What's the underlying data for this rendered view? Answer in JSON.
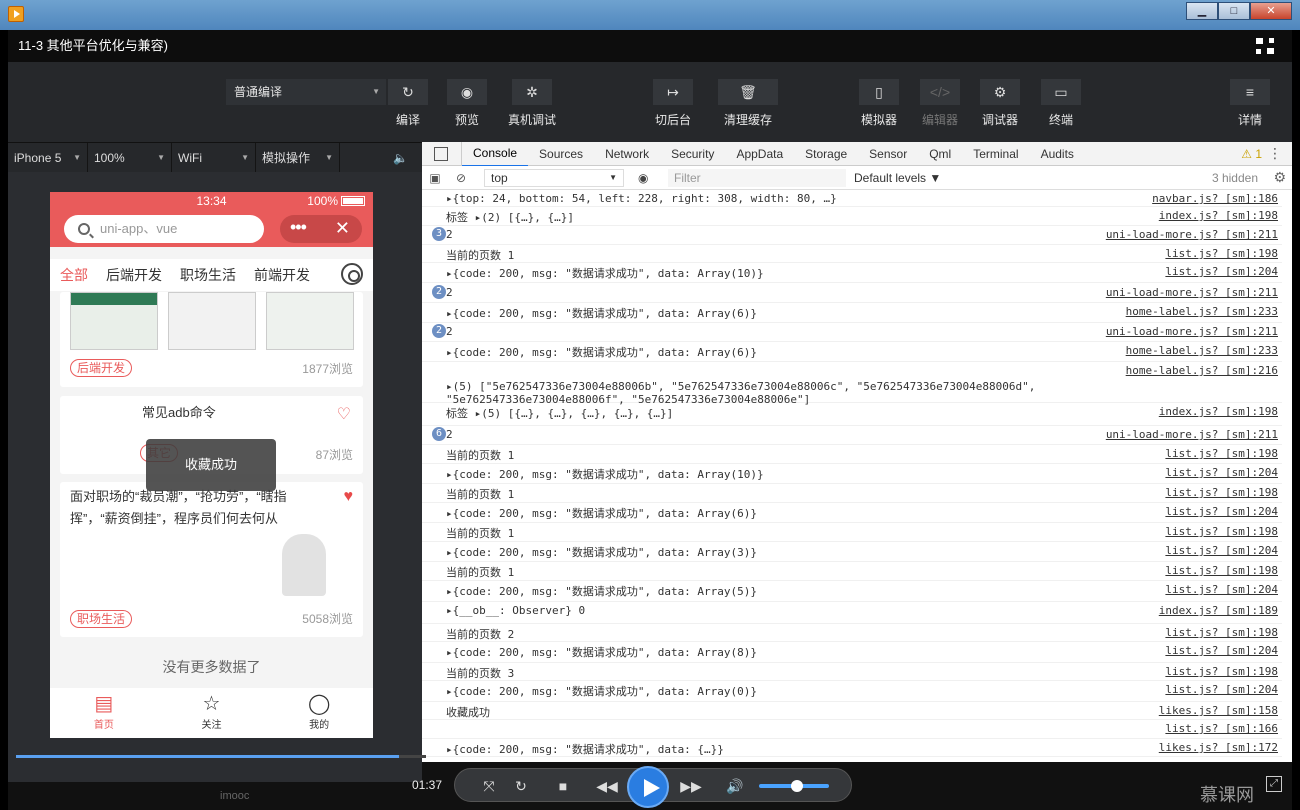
{
  "window": {
    "min": "▁",
    "max": "□",
    "close": "✕"
  },
  "video": {
    "title": "11-3 其他平台优化与兼容)",
    "timecode": "01:37",
    "brand": "慕课网",
    "watermark": "imooc"
  },
  "toolbar": {
    "mode": "普通编译",
    "buttons": [
      {
        "label": "编译",
        "icon": "↻"
      },
      {
        "label": "预览",
        "icon": "◉"
      },
      {
        "label": "真机调试",
        "icon": "✲"
      },
      {
        "label": "切后台",
        "icon": "↦"
      },
      {
        "label": "清理缓存",
        "icon": "🗑"
      },
      {
        "label": "模拟器",
        "icon": "▯"
      },
      {
        "label": "编辑器",
        "icon": "</>"
      },
      {
        "label": "调试器",
        "icon": "⚙"
      },
      {
        "label": "终端",
        "icon": "▭"
      },
      {
        "label": "详情",
        "icon": "≡"
      }
    ]
  },
  "simbar": {
    "device": "iPhone 5",
    "zoom": "100%",
    "network": "WiFi",
    "ops": "模拟操作",
    "sound": "🔈"
  },
  "phone": {
    "status": {
      "time": "13:34",
      "battery": "100%"
    },
    "search_placeholder": "uni-app、vue",
    "capsule": {
      "more": "•••",
      "close": "✕"
    },
    "tabs": [
      "全部",
      "后端开发",
      "职场生活",
      "前端开发"
    ],
    "cards": [
      {
        "tag": "后端开发",
        "views": "1877浏览"
      },
      {
        "title": "常见adb命令",
        "tag": "其它",
        "views": "87浏览"
      },
      {
        "title": "面对职场的“裁员潮”，“抢功劳”，“瞎指挥”，“薪资倒挂”，程序员们何去何从",
        "tag": "职场生活",
        "views": "5058浏览"
      }
    ],
    "toast": "收藏成功",
    "nomore": "没有更多数据了",
    "nav": [
      {
        "label": "首页",
        "icon": "▤"
      },
      {
        "label": "关注",
        "icon": "☆"
      },
      {
        "label": "我的",
        "icon": "◯"
      }
    ]
  },
  "devtools": {
    "tabs": [
      "Console",
      "Sources",
      "Network",
      "Security",
      "AppData",
      "Storage",
      "Sensor",
      "Qml",
      "Terminal",
      "Audits"
    ],
    "warn": "⚠ 1",
    "more": "⋮",
    "context": "top",
    "filter_placeholder": "Filter",
    "levels": "Default levels ▼",
    "hidden": "3 hidden",
    "rows": [
      {
        "msg": "▸{top: 24, bottom: 54, left: 228, right: 308, width: 80, …}",
        "src": "navbar.js? [sm]:186"
      },
      {
        "msg": "标签  ▸(2) [{…}, {…}]",
        "src": "index.js? [sm]:198"
      },
      {
        "cnt": "3",
        "msg": "2",
        "src": "uni-load-more.js? [sm]:211"
      },
      {
        "msg": "当前的页数 1",
        "src": "list.js? [sm]:198"
      },
      {
        "msg": "▸{code: 200, msg: \"数据请求成功\", data: Array(10)}",
        "src": "list.js? [sm]:204"
      },
      {
        "cnt": "2",
        "msg": "2",
        "src": "uni-load-more.js? [sm]:211"
      },
      {
        "msg": "▸{code: 200, msg: \"数据请求成功\", data: Array(6)}",
        "src": "home-label.js? [sm]:233"
      },
      {
        "cnt": "2",
        "msg": "2",
        "src": "uni-load-more.js? [sm]:211"
      },
      {
        "msg": "▸{code: 200, msg: \"数据请求成功\", data: Array(6)}",
        "src": "home-label.js? [sm]:233"
      },
      {
        "msg": "▸(5) [\"5e762547336e73004e88006b\", \"5e762547336e73004e88006c\", \"5e762547336e73004e88006d\", \"5e762547336e73004e88006f\", \"5e762547336e73004e88006e\"]",
        "src": "home-label.js? [sm]:216"
      },
      {
        "msg": "标签  ▸(5) [{…}, {…}, {…}, {…}, {…}]",
        "src": "index.js? [sm]:198"
      },
      {
        "cnt": "6",
        "msg": "2",
        "src": "uni-load-more.js? [sm]:211"
      },
      {
        "msg": "当前的页数 1",
        "src": "list.js? [sm]:198"
      },
      {
        "msg": "▸{code: 200, msg: \"数据请求成功\", data: Array(10)}",
        "src": "list.js? [sm]:204"
      },
      {
        "msg": "当前的页数 1",
        "src": "list.js? [sm]:198"
      },
      {
        "msg": "▸{code: 200, msg: \"数据请求成功\", data: Array(6)}",
        "src": "list.js? [sm]:204"
      },
      {
        "msg": "当前的页数 1",
        "src": "list.js? [sm]:198"
      },
      {
        "msg": "▸{code: 200, msg: \"数据请求成功\", data: Array(3)}",
        "src": "list.js? [sm]:204"
      },
      {
        "msg": "当前的页数 1",
        "src": "list.js? [sm]:198"
      },
      {
        "msg": "▸{code: 200, msg: \"数据请求成功\", data: Array(5)}",
        "src": "list.js? [sm]:204"
      },
      {
        "msg": "▸{__ob__: Observer} 0",
        "src": "index.js? [sm]:189"
      },
      {
        "msg": "当前的页数 2",
        "src": "list.js? [sm]:198"
      },
      {
        "msg": "▸{code: 200, msg: \"数据请求成功\", data: Array(8)}",
        "src": "list.js? [sm]:204"
      },
      {
        "msg": "当前的页数 3",
        "src": "list.js? [sm]:198"
      },
      {
        "msg": "▸{code: 200, msg: \"数据请求成功\", data: Array(0)}",
        "src": "list.js? [sm]:204"
      },
      {
        "msg": "收藏成功",
        "src": "likes.js? [sm]:158"
      },
      {
        "msg": "",
        "src": "list.js? [sm]:166"
      },
      {
        "msg": "▸{code: 200, msg: \"数据请求成功\", data: {…}}",
        "src": "likes.js? [sm]:172"
      }
    ]
  },
  "player": {
    "progress": 0.935
  }
}
